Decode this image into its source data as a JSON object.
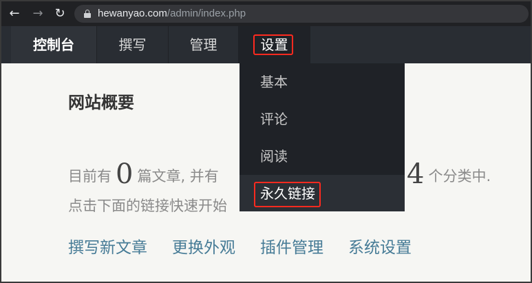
{
  "browser": {
    "back_glyph": "←",
    "forward_glyph": "→",
    "reload_glyph": "↻",
    "url_host": "hewanyao.com",
    "url_path": "/admin/index.php"
  },
  "admin_nav": {
    "tabs": [
      {
        "label": "控制台"
      },
      {
        "label": "撰写"
      },
      {
        "label": "管理"
      },
      {
        "label": "设置"
      }
    ]
  },
  "settings_menu": {
    "items": [
      {
        "label": "基本"
      },
      {
        "label": "评论"
      },
      {
        "label": "阅读"
      },
      {
        "label": "永久链接"
      }
    ]
  },
  "main": {
    "title": "网站概要",
    "summary_prefix": "目前有",
    "post_count": "0",
    "summary_mid": "篇文章, 并有",
    "category_count": "4",
    "summary_suffix": "个分类中.",
    "summary_line2": "点击下面的链接快速开始",
    "quick_links": [
      {
        "label": "撰写新文章"
      },
      {
        "label": "更换外观"
      },
      {
        "label": "插件管理"
      },
      {
        "label": "系统设置"
      }
    ]
  },
  "colors": {
    "highlight": "#ff2a1f",
    "link": "#467b96",
    "nav_bg": "#292d33"
  }
}
